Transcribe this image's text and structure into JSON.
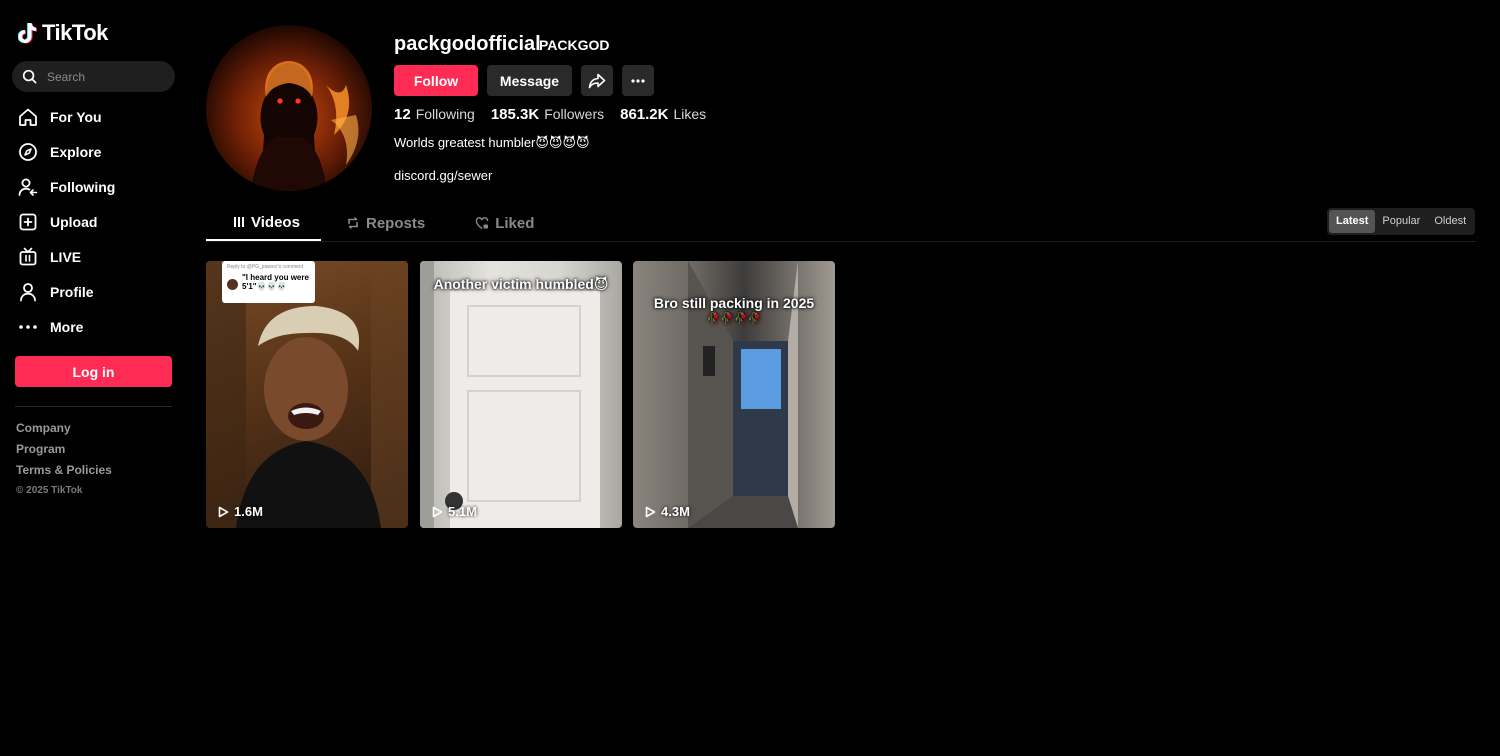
{
  "app": {
    "name": "TikTok"
  },
  "sidebar": {
    "search_placeholder": "Search",
    "nav": [
      {
        "label": "For You",
        "icon": "home-icon"
      },
      {
        "label": "Explore",
        "icon": "compass-icon"
      },
      {
        "label": "Following",
        "icon": "following-icon"
      },
      {
        "label": "Upload",
        "icon": "upload-icon"
      },
      {
        "label": "LIVE",
        "icon": "live-tv-icon"
      },
      {
        "label": "Profile",
        "icon": "person-icon"
      },
      {
        "label": "More",
        "icon": "more-dots-icon"
      }
    ],
    "login_label": "Log in",
    "footer": {
      "company": "Company",
      "program": "Program",
      "terms": "Terms & Policies",
      "copyright": "© 2025 TikTok"
    }
  },
  "profile": {
    "username": "packgodofficial",
    "nickname": "PACKGOD",
    "follow_label": "Follow",
    "message_label": "Message",
    "following_count": "12",
    "following_label": "Following",
    "followers_count": "185.3K",
    "followers_label": "Followers",
    "likes_count": "861.2K",
    "likes_label": "Likes",
    "bio": "Worlds greatest humbler😈😈😈😈",
    "link": "discord.gg/sewer"
  },
  "tabs": [
    {
      "label": "Videos",
      "active": true
    },
    {
      "label": "Reposts",
      "active": false
    },
    {
      "label": "Liked",
      "active": false
    }
  ],
  "sort": {
    "options": [
      "Latest",
      "Popular",
      "Oldest"
    ],
    "selected": "Latest"
  },
  "videos": [
    {
      "views": "1.6M",
      "caption": "",
      "reply_header": "Reply to @PG_pawscr's comment",
      "reply_text": "\"I heard you were 5'1\"💀💀💀"
    },
    {
      "views": "5.1M",
      "caption": "Another victim humbled😈"
    },
    {
      "views": "4.3M",
      "caption": "Bro still packing in 2025",
      "caption_emoji": "🥀🥀🥀🥀"
    }
  ],
  "colors": {
    "accent": "#fe2c55",
    "background": "#000000",
    "button_dark": "#2a2a2a"
  }
}
